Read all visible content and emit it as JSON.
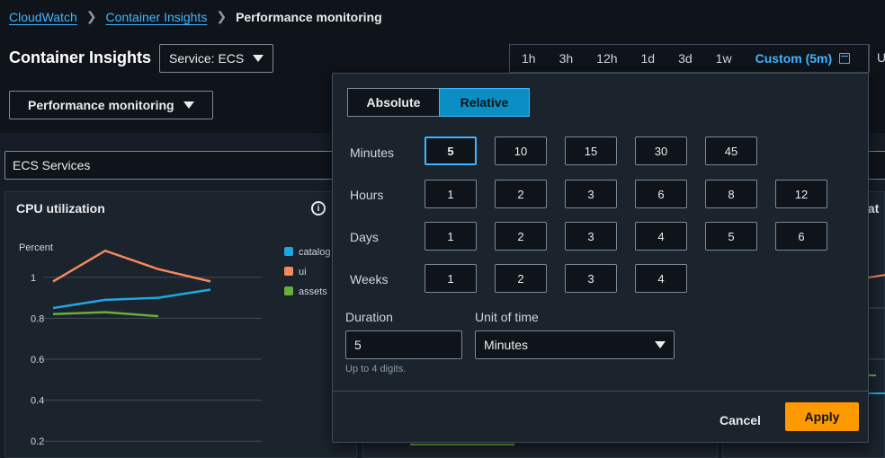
{
  "breadcrumb": {
    "items": [
      "CloudWatch",
      "Container Insights"
    ],
    "current": "Performance monitoring"
  },
  "header": {
    "title": "Container Insights",
    "service_select": "Service: ECS",
    "view_select": "Performance monitoring"
  },
  "time_range": {
    "options": [
      "1h",
      "3h",
      "12h",
      "1d",
      "3d",
      "1w"
    ],
    "custom_label": "Custom (5m)",
    "overflow_label": "U"
  },
  "filter": {
    "value": "ECS Services"
  },
  "cards": {
    "cpu": {
      "title": "CPU utilization",
      "info_icon": "info-icon"
    },
    "right_title_fragment": "izat"
  },
  "chart_data": {
    "type": "line",
    "title": "CPU utilization",
    "ylabel": "Percent",
    "yticks": [
      "1",
      "0.8",
      "0.6",
      "0.4",
      "0.2"
    ],
    "ylim": [
      0.1,
      1.1
    ],
    "x": [
      0,
      1,
      2,
      3
    ],
    "series": [
      {
        "name": "catalog",
        "color": "#1ea7e1",
        "values": [
          0.85,
          0.89,
          0.9,
          0.94
        ]
      },
      {
        "name": "ui",
        "color": "#f5895b",
        "values": [
          0.98,
          1.13,
          1.04,
          0.98
        ]
      },
      {
        "name": "assets",
        "color": "#6aad3b",
        "values": [
          0.82,
          0.83,
          0.81,
          null
        ]
      }
    ],
    "legend": "right",
    "grid": true
  },
  "popover": {
    "mode_absolute": "Absolute",
    "mode_relative": "Relative",
    "rows": {
      "minutes": {
        "label": "Minutes",
        "options": [
          "5",
          "10",
          "15",
          "30",
          "45"
        ]
      },
      "hours": {
        "label": "Hours",
        "options": [
          "1",
          "2",
          "3",
          "6",
          "8",
          "12"
        ]
      },
      "days": {
        "label": "Days",
        "options": [
          "1",
          "2",
          "3",
          "4",
          "5",
          "6"
        ]
      },
      "weeks": {
        "label": "Weeks",
        "options": [
          "1",
          "2",
          "3",
          "4"
        ]
      }
    },
    "duration_label": "Duration",
    "duration_value": "5",
    "unit_label": "Unit of time",
    "unit_value": "Minutes",
    "hint": "Up to 4 digits.",
    "cancel": "Cancel",
    "apply": "Apply"
  },
  "colors": {
    "accent": "#42b4ff",
    "apply": "#ff9900",
    "relative_active": "#0b8ec4"
  }
}
